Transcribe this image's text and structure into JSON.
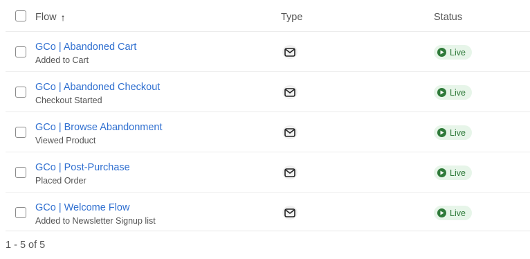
{
  "header": {
    "flow_label": "Flow",
    "type_label": "Type",
    "status_label": "Status"
  },
  "rows": [
    {
      "name": "GCo | Abandoned Cart",
      "trigger": "Added to Cart",
      "type_icon": "email-icon",
      "status": "Live"
    },
    {
      "name": "GCo | Abandoned Checkout",
      "trigger": "Checkout Started",
      "type_icon": "email-icon",
      "status": "Live"
    },
    {
      "name": "GCo | Browse Abandonment",
      "trigger": "Viewed Product",
      "type_icon": "email-icon",
      "status": "Live"
    },
    {
      "name": "GCo | Post-Purchase",
      "trigger": "Placed Order",
      "type_icon": "email-icon",
      "status": "Live"
    },
    {
      "name": "GCo | Welcome Flow",
      "trigger": "Added to Newsletter Signup list",
      "type_icon": "email-icon",
      "status": "Live"
    }
  ],
  "pagination": {
    "text": "1 - 5 of 5"
  },
  "colors": {
    "link": "#2f6fd0",
    "live_badge_bg": "#e7f5e9",
    "live_text": "#2f7a3a"
  }
}
